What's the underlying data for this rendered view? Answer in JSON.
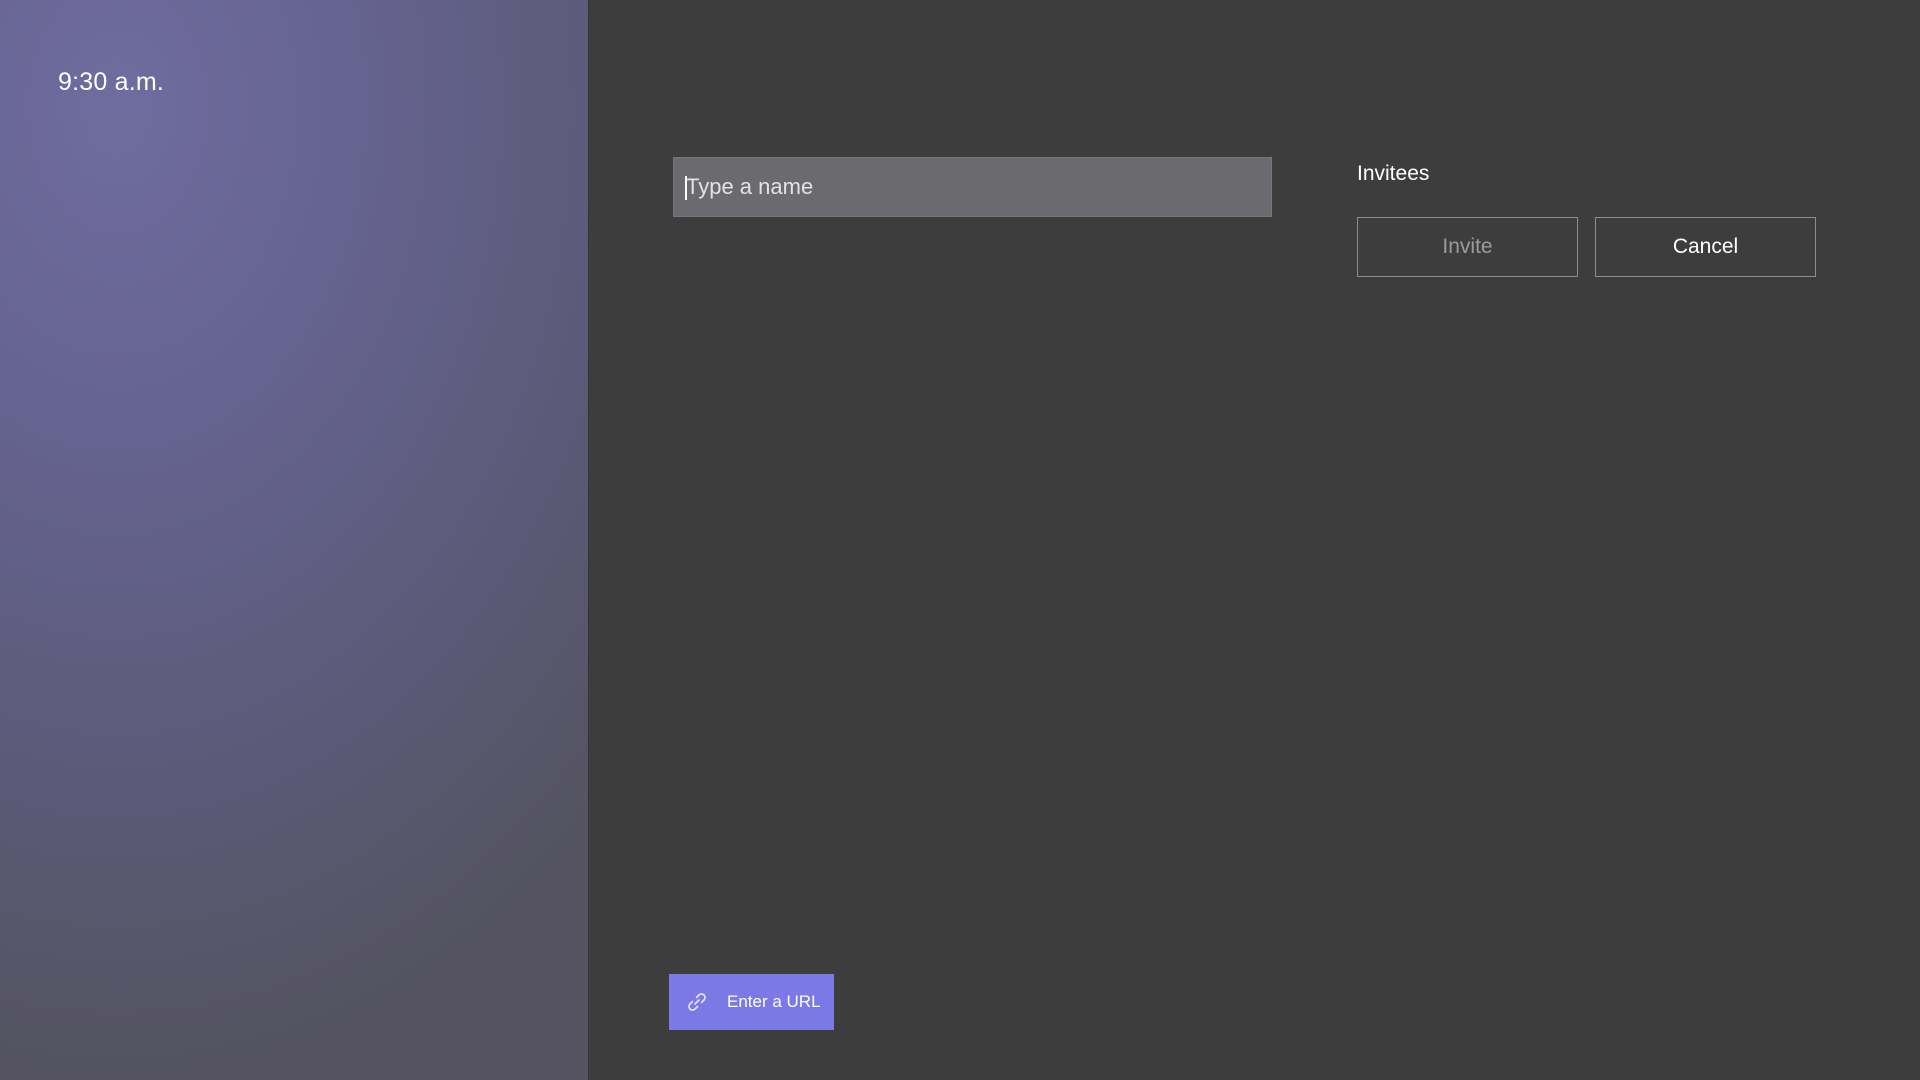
{
  "sidebar": {
    "time": "9:30 a.m."
  },
  "invite_form": {
    "name_input": {
      "placeholder": "Type a name",
      "value": ""
    },
    "invitees_label": "Invitees",
    "invite_label": "Invite",
    "cancel_label": "Cancel"
  },
  "footer": {
    "url_button_label": "Enter a URL",
    "url_button_icon": "link-icon"
  },
  "colors": {
    "accent": "#7b79e6",
    "panel_background": "#3e3d3e",
    "input_background": "#6b6a6e"
  }
}
